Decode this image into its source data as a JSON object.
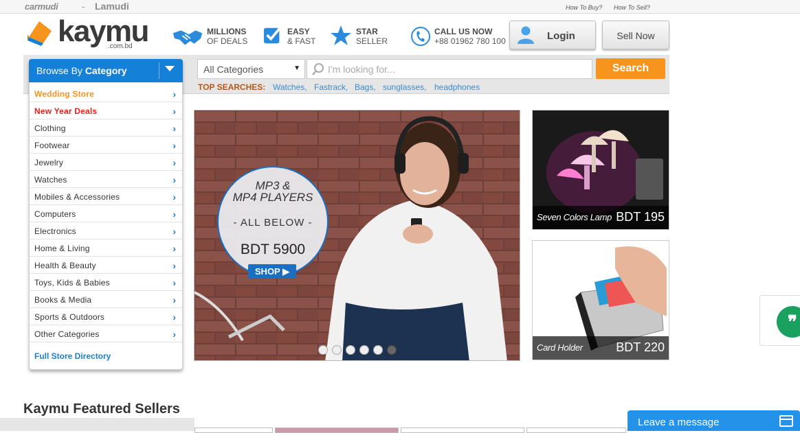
{
  "topbar": {
    "brand1": "carmudi",
    "separator": "-",
    "brand2": "Lamudi",
    "links": [
      "How To Buy?",
      "How To Sell?"
    ]
  },
  "header": {
    "logo_text": "kaymu",
    "logo_sub": ".com.bd",
    "features": [
      {
        "line1": "MILLIONS",
        "line2": "OF DEALS",
        "icon": "handshake-icon"
      },
      {
        "line1": "EASY",
        "line2": "& FAST",
        "icon": "checkbox-icon"
      },
      {
        "line1": "STAR",
        "line2": "SELLER",
        "icon": "star-icon"
      },
      {
        "line1": "CALL US NOW",
        "line2": "+88 01962 780 100",
        "icon": "phone-icon"
      }
    ],
    "login_label": "Login",
    "sell_label": "Sell Now"
  },
  "search": {
    "category_value": "All Categories",
    "placeholder": "I'm looking for...",
    "button_label": "Search",
    "top_searches_label": "TOP SEARCHES:",
    "top_searches": [
      "Watches,",
      "Fastrack,",
      "Bags,",
      "sunglasses,",
      "headphones"
    ]
  },
  "sidebar": {
    "title_light": "Browse By ",
    "title_bold": "Category",
    "items": [
      {
        "label": "Wedding Store",
        "color": "#f7941d",
        "bold": true
      },
      {
        "label": "New Year Deals",
        "color": "#e0231b",
        "bold": true
      },
      {
        "label": "Clothing"
      },
      {
        "label": "Footwear"
      },
      {
        "label": "Jewelry"
      },
      {
        "label": "Watches"
      },
      {
        "label": "Mobiles & Accessories"
      },
      {
        "label": "Computers"
      },
      {
        "label": "Electronics"
      },
      {
        "label": "Home & Living"
      },
      {
        "label": "Health & Beauty"
      },
      {
        "label": "Toys, Kids & Babies"
      },
      {
        "label": "Books & Media"
      },
      {
        "label": "Sports & Outdoors"
      },
      {
        "label": "Other Categories"
      }
    ],
    "full_directory": "Full Store Directory"
  },
  "banner": {
    "line1": "MP3 &",
    "line2": "MP4 PLAYERS",
    "subtitle": "- ALL BELOW -",
    "price": "BDT 5900",
    "shop_label": "SHOP ▶",
    "slide_count": 6,
    "active_slide": 6
  },
  "products": [
    {
      "name": "Seven Colors Lamp",
      "price": "BDT 195"
    },
    {
      "name": "Card Holder",
      "price": "BDT 220"
    }
  ],
  "featured": {
    "title": "Kaymu Featured Sellers"
  },
  "chat": {
    "label": "Leave a message"
  },
  "colors": {
    "brand_blue": "#1580d8",
    "search_orange": "#f7941d",
    "link_blue": "#3a8ad0"
  }
}
